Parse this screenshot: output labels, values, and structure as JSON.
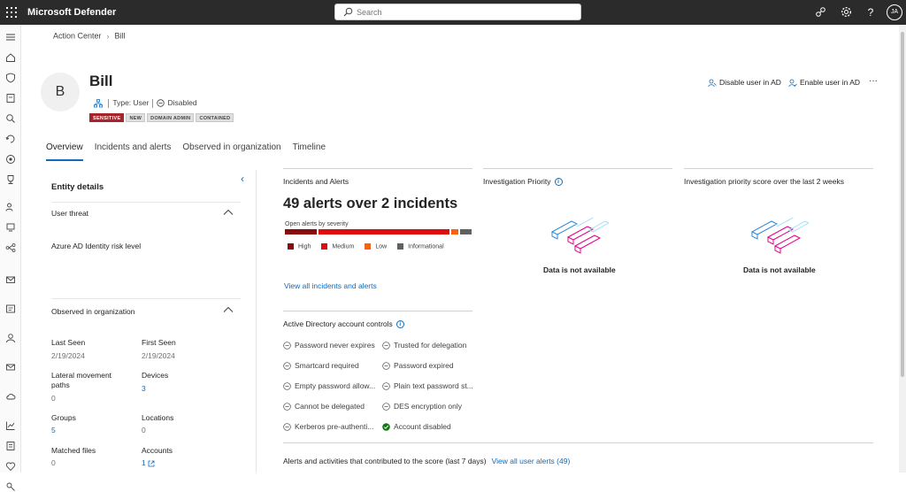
{
  "header": {
    "app_title": "Microsoft Defender",
    "search_placeholder": "Search",
    "user_initials": "JA"
  },
  "breadcrumb": {
    "parent": "Action Center",
    "current": "Bill"
  },
  "entity": {
    "avatar_letter": "B",
    "name": "Bill",
    "type": "Type: User",
    "status": "Disabled",
    "tags": [
      "SENSITIVE",
      "NEW",
      "DOMAIN ADMIN",
      "CONTAINED"
    ]
  },
  "actions": {
    "disable_user": "Disable user in AD",
    "enable_user": "Enable user in AD",
    "more": "···"
  },
  "tabs": [
    "Overview",
    "Incidents and alerts",
    "Observed in organization",
    "Timeline"
  ],
  "entity_details": {
    "title": "Entity details",
    "user_threat": {
      "heading": "User threat",
      "risk_label": "Azure AD Identity risk level"
    },
    "observed": {
      "heading": "Observed in organization",
      "last_seen_label": "Last Seen",
      "last_seen_value": "2/19/2024",
      "first_seen_label": "First Seen",
      "first_seen_value": "2/19/2024",
      "lateral_label": "Lateral movement paths",
      "lateral_value": "0",
      "devices_label": "Devices",
      "devices_value": "3",
      "groups_label": "Groups",
      "groups_value": "5",
      "locations_label": "Locations",
      "locations_value": "0",
      "matched_files_label": "Matched files",
      "matched_files_value": "0",
      "accounts_label": "Accounts",
      "accounts_value": "1"
    }
  },
  "incidents": {
    "title": "Incidents and Alerts",
    "headline": "49 alerts over 2 incidents",
    "severity_caption": "Open alerts by severity",
    "severity": [
      {
        "name": "High",
        "color": "#8a0b0b",
        "share": 0.17
      },
      {
        "name": "Medium",
        "color": "#e00b0b",
        "share": 0.7
      },
      {
        "name": "Low",
        "color": "#f7630c",
        "share": 0.04
      },
      {
        "name": "Informational",
        "color": "#616161",
        "share": 0.06
      }
    ],
    "view_all_link": "View all incidents and alerts"
  },
  "investigation_priority": {
    "title": "Investigation Priority",
    "empty_text": "Data is not available"
  },
  "priority_score": {
    "title": "Investigation priority score over the last 2 weeks",
    "empty_text": "Data is not available"
  },
  "ad_controls": {
    "title": "Active Directory account controls",
    "items": [
      {
        "label": "Password never expires",
        "enabled": false
      },
      {
        "label": "Trusted for delegation",
        "enabled": false
      },
      {
        "label": "Smartcard required",
        "enabled": false
      },
      {
        "label": "Password expired",
        "enabled": false
      },
      {
        "label": "Empty password allow...",
        "enabled": false
      },
      {
        "label": "Plain text password st...",
        "enabled": false
      },
      {
        "label": "Cannot be delegated",
        "enabled": false
      },
      {
        "label": "DES encryption only",
        "enabled": false
      },
      {
        "label": "Kerberos pre-authenti...",
        "enabled": false
      },
      {
        "label": "Account disabled",
        "enabled": true
      }
    ]
  },
  "contributing": {
    "title": "Alerts and activities that contributed to the score (last 7 days)",
    "link": "View all user alerts (49)"
  }
}
